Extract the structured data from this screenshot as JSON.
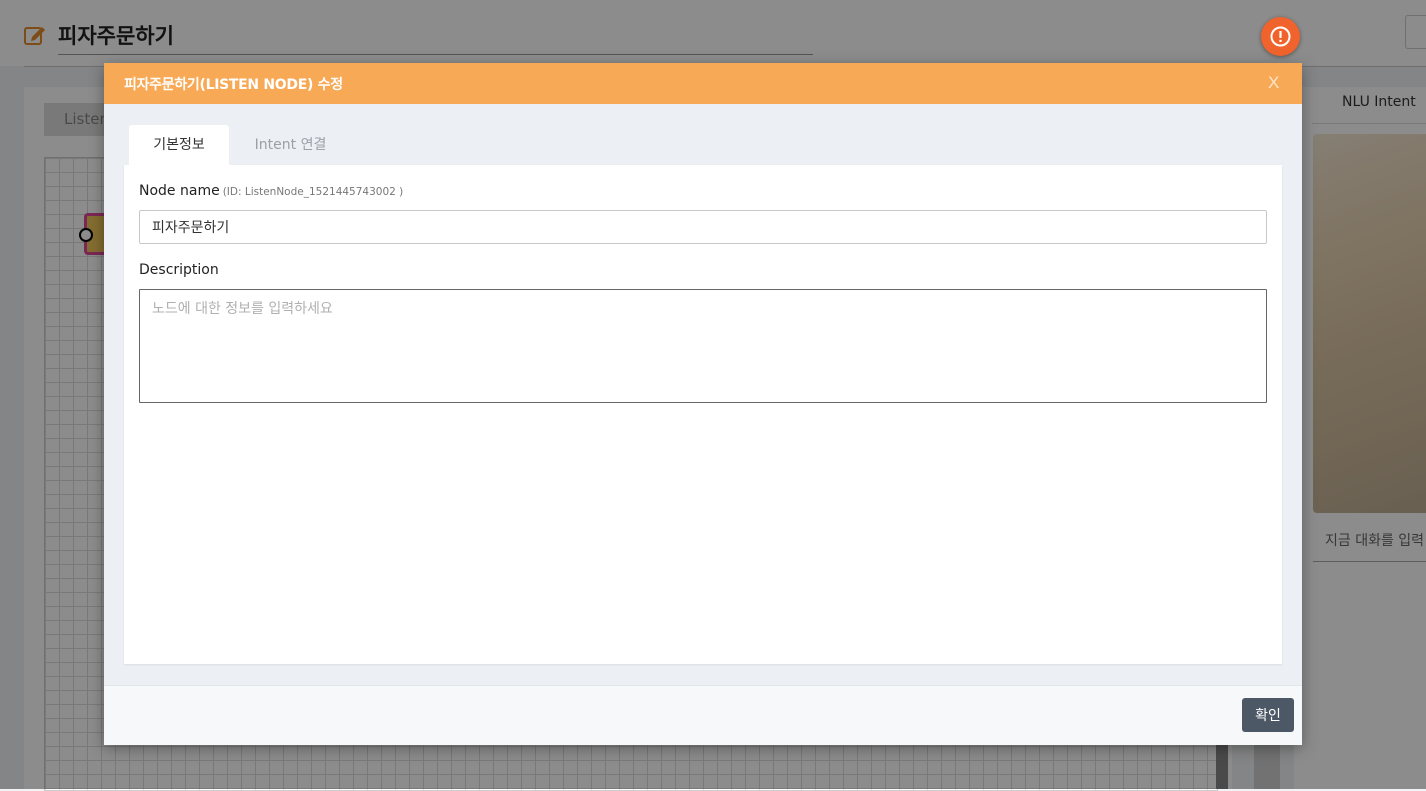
{
  "page": {
    "title": "피자주문하기",
    "canvas_tab": "Listen",
    "right_panel_title": "NLU Intent",
    "chat_placeholder": "지금 대화를 입력"
  },
  "modal": {
    "title": "피자주문하기(LISTEN NODE) 수정",
    "close_label": "X",
    "tabs": [
      "기본정보",
      "Intent 연결"
    ],
    "node_name_label": "Node name",
    "node_id": "(ID: ListenNode_1521445743002 )",
    "node_name_value": "피자주문하기",
    "description_label": "Description",
    "description_placeholder": "노드에 대한 정보를 입력하세요",
    "confirm_label": "확인"
  },
  "colors": {
    "header_accent": "#f8a955",
    "alert": "#f0632c",
    "confirm_button": "#4d5866"
  },
  "icons": {
    "title_icon": "edit-icon",
    "alert_icon": "alert-icon"
  }
}
